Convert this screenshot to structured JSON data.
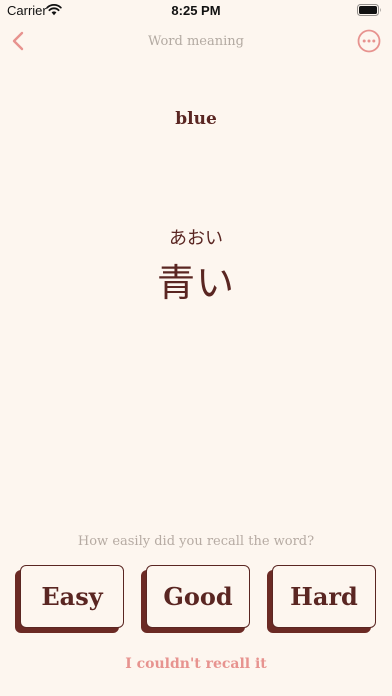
{
  "status_bar": {
    "carrier": "Carrier",
    "time": "8:25 PM"
  },
  "nav": {
    "title": "Word meaning",
    "back_icon": "chevron-left-icon",
    "more_icon": "more-circle-icon"
  },
  "card": {
    "meaning": "blue",
    "reading": "あおい",
    "word": "青い"
  },
  "recall": {
    "prompt": "How easily did you recall the word?",
    "buttons": {
      "easy": "Easy",
      "good": "Good",
      "hard": "Hard"
    },
    "fail_label": "I couldn't recall it"
  },
  "colors": {
    "background": "#fdf6ef",
    "primary": "#5a2622",
    "accent": "#e7938f",
    "muted": "#b3aaa2"
  }
}
